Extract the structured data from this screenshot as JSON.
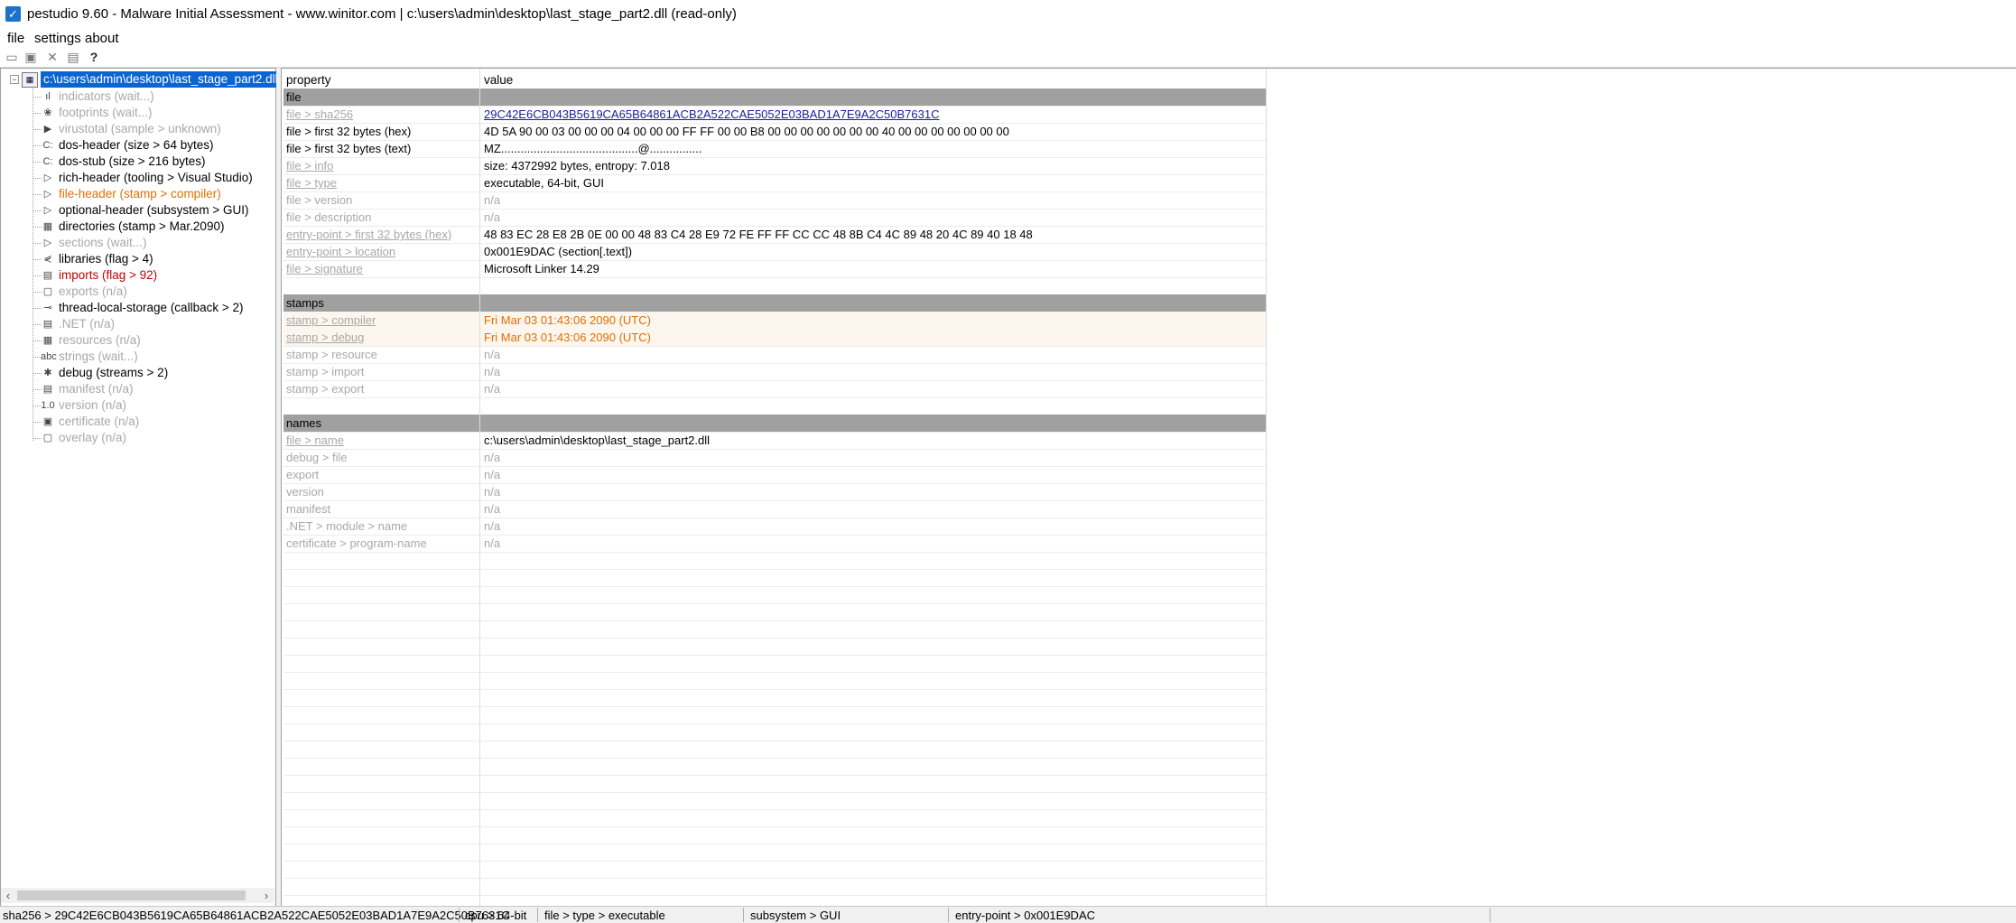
{
  "window": {
    "title": "pestudio 9.60 - Malware Initial Assessment - www.winitor.com | c:\\users\\admin\\desktop\\last_stage_part2.dll (read-only)"
  },
  "menu": {
    "file": "file",
    "settings": "settings",
    "about": "about"
  },
  "tree": {
    "root": "c:\\users\\admin\\desktop\\last_stage_part2.dll",
    "items": [
      {
        "label": "indicators (wait...)",
        "style": "grey",
        "icon": "indicators-icon",
        "glyph": "ıl"
      },
      {
        "label": "footprints (wait...)",
        "style": "grey",
        "icon": "footprints-icon",
        "glyph": "❀"
      },
      {
        "label": "virustotal (sample > unknown)",
        "style": "grey",
        "icon": "virustotal-icon",
        "glyph": "▶"
      },
      {
        "label": "dos-header (size > 64 bytes)",
        "style": "black",
        "icon": "dos-header-icon",
        "glyph": "C:"
      },
      {
        "label": "dos-stub (size > 216 bytes)",
        "style": "black",
        "icon": "dos-stub-icon",
        "glyph": "C:"
      },
      {
        "label": "rich-header (tooling > Visual Studio)",
        "style": "black",
        "icon": "rich-header-icon",
        "glyph": "▷"
      },
      {
        "label": "file-header (stamp > compiler)",
        "style": "orange",
        "icon": "file-header-icon",
        "glyph": "▷"
      },
      {
        "label": "optional-header (subsystem > GUI)",
        "style": "black",
        "icon": "optional-header-icon",
        "glyph": "▷"
      },
      {
        "label": "directories (stamp > Mar.2090)",
        "style": "black",
        "icon": "directories-icon",
        "glyph": "▦"
      },
      {
        "label": "sections (wait...)",
        "style": "grey",
        "icon": "sections-icon",
        "glyph": "▷"
      },
      {
        "label": "libraries (flag > 4)",
        "style": "black",
        "icon": "libraries-icon",
        "glyph": "⋞"
      },
      {
        "label": "imports (flag > 92)",
        "style": "red",
        "icon": "imports-icon",
        "glyph": "▤"
      },
      {
        "label": "exports (n/a)",
        "style": "grey",
        "icon": "exports-icon",
        "glyph": "▢"
      },
      {
        "label": "thread-local-storage (callback > 2)",
        "style": "black",
        "icon": "tls-icon",
        "glyph": "⊸"
      },
      {
        "label": ".NET (n/a)",
        "style": "grey",
        "icon": "dotnet-icon",
        "glyph": "▤"
      },
      {
        "label": "resources (n/a)",
        "style": "grey",
        "icon": "resources-icon",
        "glyph": "▦"
      },
      {
        "label": "strings (wait...)",
        "style": "grey",
        "icon": "strings-icon",
        "glyph": "abc"
      },
      {
        "label": "debug (streams > 2)",
        "style": "black",
        "icon": "debug-icon",
        "glyph": "✱"
      },
      {
        "label": "manifest (n/a)",
        "style": "grey",
        "icon": "manifest-icon",
        "glyph": "▤"
      },
      {
        "label": "version (n/a)",
        "style": "grey",
        "icon": "version-icon",
        "glyph": "1.0"
      },
      {
        "label": "certificate (n/a)",
        "style": "grey",
        "icon": "certificate-icon",
        "glyph": "▣"
      },
      {
        "label": "overlay (n/a)",
        "style": "grey",
        "icon": "overlay-icon",
        "glyph": "▢"
      }
    ]
  },
  "grid": {
    "header": {
      "property": "property",
      "value": "value"
    },
    "rows": [
      {
        "kind": "section",
        "p": "file",
        "v": ""
      },
      {
        "kind": "grey",
        "p": "file > sha256",
        "v": "29C42E6CB043B5619CA65B64861ACB2A522CAE5052E03BAD1A7E9A2C50B7631C",
        "plink": true,
        "vclass": "blue link"
      },
      {
        "kind": "black",
        "p": "file > first 32 bytes (hex)",
        "v": "4D 5A 90 00 03 00 00 00 04 00 00 00 FF FF 00 00 B8 00 00 00 00 00 00 00 40 00 00 00 00 00 00 00"
      },
      {
        "kind": "black",
        "p": "file > first 32 bytes (text)",
        "v": "MZ..........................................@................"
      },
      {
        "kind": "grey",
        "p": "file > info",
        "v": "size: 4372992 bytes, entropy: 7.018",
        "plink": true,
        "vclass": "black"
      },
      {
        "kind": "grey",
        "p": "file > type",
        "v": "executable, 64-bit, GUI",
        "plink": true,
        "vclass": "black"
      },
      {
        "kind": "grey",
        "p": "file > version",
        "v": "n/a"
      },
      {
        "kind": "grey",
        "p": "file > description",
        "v": "n/a"
      },
      {
        "kind": "grey",
        "p": "entry-point > first 32 bytes (hex)",
        "v": "48 83 EC 28 E8 2B 0E 00 00 48 83 C4 28 E9 72 FE FF FF CC CC 48 8B C4 4C 89 48 20 4C 89 40 18 48",
        "plink": true,
        "vclass": "black"
      },
      {
        "kind": "grey",
        "p": "entry-point > location",
        "v": "0x001E9DAC (section[.text])",
        "plink": true,
        "vclass": "black"
      },
      {
        "kind": "grey",
        "p": "file > signature",
        "v": "Microsoft Linker 14.29",
        "plink": true,
        "vclass": "black"
      },
      {
        "kind": "blank",
        "p": "",
        "v": ""
      },
      {
        "kind": "section",
        "p": "stamps",
        "v": ""
      },
      {
        "kind": "grey",
        "p": "stamp > compiler",
        "v": "Fri Mar 03 01:43:06 2090 (UTC)",
        "plink": true,
        "vclass": "orange",
        "bg": "stampsel"
      },
      {
        "kind": "grey",
        "p": "stamp > debug",
        "v": "Fri Mar 03 01:43:06 2090 (UTC)",
        "plink": true,
        "vclass": "orange",
        "bg": "stampsel"
      },
      {
        "kind": "grey",
        "p": "stamp > resource",
        "v": "n/a"
      },
      {
        "kind": "grey",
        "p": "stamp > import",
        "v": "n/a"
      },
      {
        "kind": "grey",
        "p": "stamp > export",
        "v": "n/a"
      },
      {
        "kind": "blank",
        "p": "",
        "v": ""
      },
      {
        "kind": "section",
        "p": "names",
        "v": ""
      },
      {
        "kind": "grey",
        "p": "file > name",
        "v": "c:\\users\\admin\\desktop\\last_stage_part2.dll",
        "plink": true,
        "vclass": "black"
      },
      {
        "kind": "grey",
        "p": "debug > file",
        "v": "n/a"
      },
      {
        "kind": "grey",
        "p": "export",
        "v": "n/a"
      },
      {
        "kind": "grey",
        "p": "version",
        "v": "n/a"
      },
      {
        "kind": "grey",
        "p": "manifest",
        "v": "n/a"
      },
      {
        "kind": "grey",
        "p": ".NET > module > name",
        "v": "n/a"
      },
      {
        "kind": "grey",
        "p": "certificate > program-name",
        "v": "n/a"
      }
    ]
  },
  "status": {
    "sha256": "sha256 > 29C42E6CB043B5619CA65B64861ACB2A522CAE5052E03BAD1A7E9A2C50B7631C",
    "cpu": "cpu > 64-bit",
    "type": "file > type > executable",
    "subsystem": "subsystem > GUI",
    "entry": "entry-point > 0x001E9DAC"
  },
  "colors": {
    "selection": "#0a64d2",
    "section": "#a0a0a0",
    "orange": "#e07000",
    "red": "#c00000",
    "link": "#1a1aa6"
  }
}
